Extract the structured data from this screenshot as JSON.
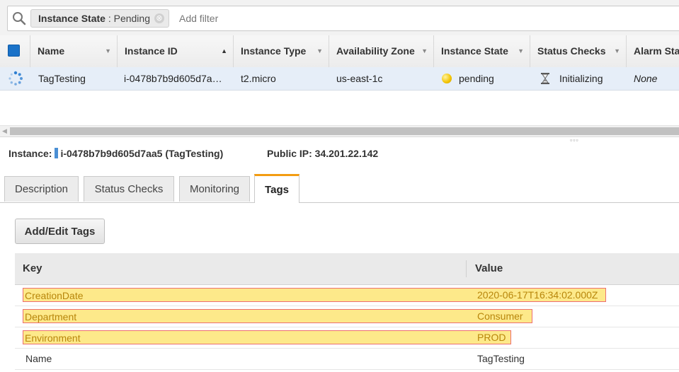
{
  "filter": {
    "token_key": "Instance State",
    "token_value": " : Pending",
    "token_close": "⊗",
    "placeholder": "Add filter"
  },
  "grid": {
    "columns": [
      {
        "label": "Name",
        "sort": "▼"
      },
      {
        "label": "Instance ID",
        "sort": "▲"
      },
      {
        "label": "Instance Type",
        "sort": "▼"
      },
      {
        "label": "Availability Zone",
        "sort": "▼"
      },
      {
        "label": "Instance State",
        "sort": "▼"
      },
      {
        "label": "Status Checks",
        "sort": "▼"
      },
      {
        "label": "Alarm Sta",
        "sort": ""
      }
    ],
    "row": {
      "name": "TagTesting",
      "instance_id": "i-0478b7b9d605d7a…",
      "instance_type": "t2.micro",
      "availability_zone": "us-east-1c",
      "instance_state": "pending",
      "status_checks": "Initializing",
      "alarm_status": "None"
    }
  },
  "details": {
    "instance_label": "Instance:",
    "instance_value": "i-0478b7b9d605d7aa5 (TagTesting)",
    "public_ip": "Public IP: 34.201.22.142",
    "tabs": [
      "Description",
      "Status Checks",
      "Monitoring",
      "Tags"
    ],
    "active_tab": "Tags",
    "add_edit_label": "Add/Edit Tags",
    "tags_header": {
      "key": "Key",
      "value": "Value"
    },
    "tags": [
      {
        "key": "CreationDate",
        "value": "2020-06-17T16:34:02.000Z",
        "highlighted": true
      },
      {
        "key": "Department",
        "value": "Consumer",
        "highlighted": true
      },
      {
        "key": "Environment",
        "value": "PROD",
        "highlighted": true
      },
      {
        "key": "Name",
        "value": "TagTesting",
        "highlighted": false
      }
    ]
  },
  "colors": {
    "accent_tab": "#f39c12",
    "selected_row": "#e6eef8",
    "highlight_fill": "#fde98a",
    "highlight_border": "#ec6f72",
    "highlight_text": "#b8860b",
    "pending_dot": "#f2c300"
  }
}
